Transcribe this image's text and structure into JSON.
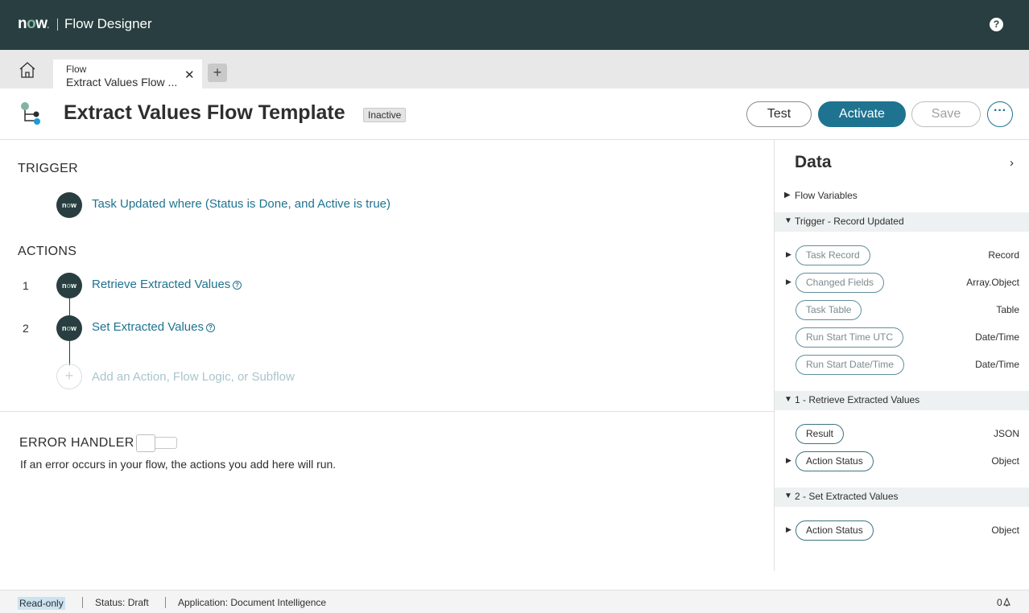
{
  "header": {
    "logo": "now",
    "app_title": "Flow Designer",
    "help_label": "?"
  },
  "tabs": {
    "home_icon": "home-icon",
    "active_tab": {
      "type": "Flow",
      "name": "Extract Values Flow ...",
      "close": "✕"
    },
    "add_label": "+"
  },
  "titlebar": {
    "flow_icon": "flow-tree-icon",
    "title": "Extract Values Flow Template",
    "status": "Inactive",
    "buttons": {
      "test": "Test",
      "activate": "Activate",
      "save": "Save",
      "more": "···"
    }
  },
  "canvas": {
    "trigger_heading": "TRIGGER",
    "trigger": {
      "node": "now",
      "label": "Task Updated where (Status is Done, and Active is true)"
    },
    "actions_heading": "ACTIONS",
    "actions": [
      {
        "num": "1",
        "node": "now",
        "label": "Retrieve Extracted Values",
        "info": "?"
      },
      {
        "num": "2",
        "node": "now",
        "label": "Set Extracted Values",
        "info": "?"
      }
    ],
    "add_action": {
      "icon": "+",
      "label": "Add an Action, Flow Logic, or Subflow"
    },
    "error_handler": {
      "heading": "ERROR HANDLER",
      "toggle_on": false,
      "description": "If an error occurs in your flow, the actions you add here will run."
    }
  },
  "data_panel": {
    "title": "Data",
    "collapse_icon": "›",
    "groups": {
      "flow_variables": {
        "label": "Flow Variables",
        "expanded": false
      },
      "trigger": {
        "label": "Trigger - Record Updated",
        "expanded": true,
        "items": [
          {
            "name": "Task Record",
            "type": "Record",
            "expandable": true
          },
          {
            "name": "Changed Fields",
            "type": "Array.Object",
            "expandable": true
          },
          {
            "name": "Task Table",
            "type": "Table",
            "expandable": false
          },
          {
            "name": "Run Start Time UTC",
            "type": "Date/Time",
            "expandable": false
          },
          {
            "name": "Run Start Date/Time",
            "type": "Date/Time",
            "expandable": false
          }
        ]
      },
      "step1": {
        "label": "1 - Retrieve Extracted Values",
        "expanded": true,
        "items": [
          {
            "name": "Result",
            "type": "JSON",
            "expandable": false
          },
          {
            "name": "Action Status",
            "type": "Object",
            "expandable": true
          }
        ]
      },
      "step2": {
        "label": "2 - Set Extracted Values",
        "expanded": true,
        "items": [
          {
            "name": "Action Status",
            "type": "Object",
            "expandable": true
          }
        ]
      }
    }
  },
  "statusbar": {
    "mode": "Read-only",
    "status": "Status: Draft",
    "application": "Application: Document Intelligence",
    "notifications": "0",
    "bell_icon": "bell-icon"
  },
  "colors": {
    "header_bg": "#293e40",
    "accent": "#1e7390",
    "brand_green": "#81b5a1"
  }
}
